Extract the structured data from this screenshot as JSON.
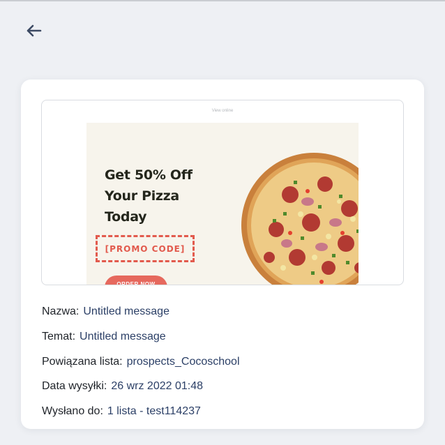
{
  "nav": {
    "back_icon": "arrow-left-icon"
  },
  "preview": {
    "view_online": "View online",
    "headline": [
      "Get 50% Off",
      "Your Pizza",
      "Today"
    ],
    "promo_code": "[PROMO CODE]",
    "cta": "ORDER NOW",
    "image": "pizza-image",
    "colors": {
      "banner_bg": "#f7f4ec",
      "accent": "#e25a4d"
    }
  },
  "details": [
    {
      "label": "Nazwa:",
      "value": "Untitled message"
    },
    {
      "label": "Temat:",
      "value": "Untitled message"
    },
    {
      "label": "Powiązana lista:",
      "value": "prospects_Cocoschool"
    },
    {
      "label": "Data wysyłki:",
      "value": "26 wrz 2022 01:48"
    },
    {
      "label": "Wysłano do:",
      "value": "1 lista - test114237"
    }
  ],
  "colors": {
    "page_bg": "#eef0f4",
    "card_bg": "#ffffff",
    "value_text": "#2b3f66"
  }
}
